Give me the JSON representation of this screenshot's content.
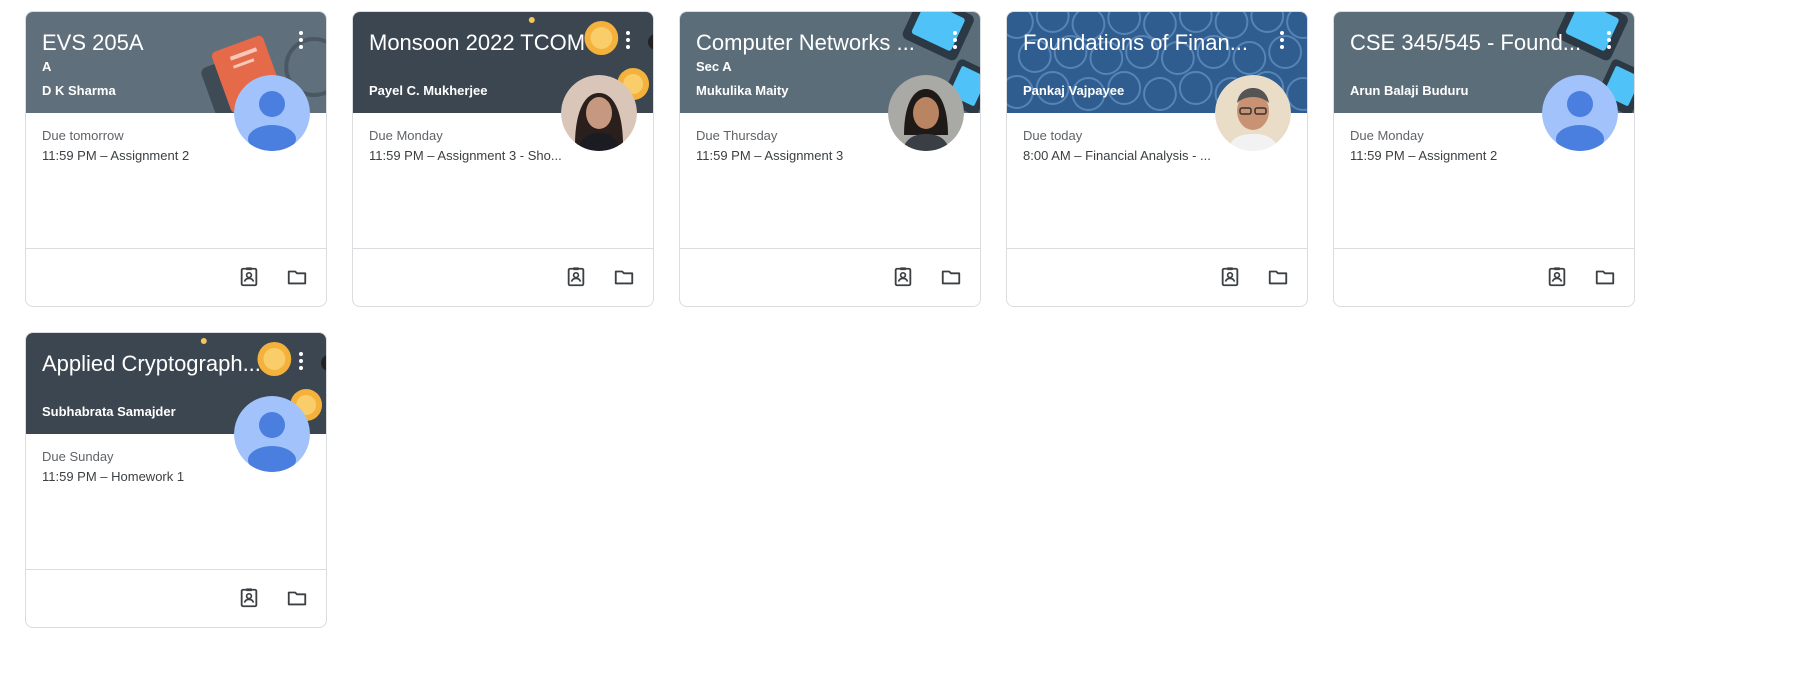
{
  "classes": [
    {
      "title": "EVS 205A",
      "section": "A",
      "teacher": "D K Sharma",
      "due_label": "Due tomorrow",
      "due_item": "11:59 PM – Assignment 2",
      "header_color": "#5f6f7c",
      "theme_icon": "book-illustration-icon",
      "avatar": "default-avatar-icon"
    },
    {
      "title": "Monsoon 2022 TCOM",
      "section": "",
      "teacher": "Payel C. Mukherjee",
      "due_label": "Due Monday",
      "due_item": "11:59 PM – Assignment 3 - Sho...",
      "header_color": "#3b4650",
      "theme_icon": "coins-illustration-icon",
      "avatar": "teacher-photo-avatar"
    },
    {
      "title": "Computer Networks ...",
      "section": "Sec A",
      "teacher": "Mukulika Maity",
      "due_label": "Due Thursday",
      "due_item": "11:59 PM – Assignment 3",
      "header_color": "#5c6d7a",
      "theme_icon": "devices-illustration-icon",
      "avatar": "teacher-photo-avatar"
    },
    {
      "title": "Foundations of Finan...",
      "section": "",
      "teacher": "Pankaj Vajpayee",
      "due_label": "Due today",
      "due_item": "8:00 AM – Financial Analysis - ...",
      "header_color": "#2f5d8f",
      "theme_icon": "coins-pattern-icon",
      "avatar": "teacher-photo-avatar"
    },
    {
      "title": "CSE 345/545 - Found...",
      "section": "",
      "teacher": "Arun Balaji Buduru",
      "due_label": "Due Monday",
      "due_item": "11:59 PM – Assignment 2",
      "header_color": "#5c6d7a",
      "theme_icon": "devices-illustration-icon",
      "avatar": "default-avatar-icon"
    },
    {
      "title": "Applied Cryptograph...",
      "section": "",
      "teacher": "Subhabrata Samajder",
      "due_label": "Due Sunday",
      "due_item": "11:59 PM – Homework 1",
      "header_color": "#3b4650",
      "theme_icon": "coins-illustration-icon",
      "avatar": "default-avatar-icon"
    }
  ],
  "footer_icons": [
    "your-work-icon",
    "folder-icon"
  ],
  "colors": {
    "border": "#dadce0",
    "avatar_bg": "#a1c2fa",
    "avatar_fg": "#4a7fe0",
    "muted_text": "#5f6368"
  }
}
